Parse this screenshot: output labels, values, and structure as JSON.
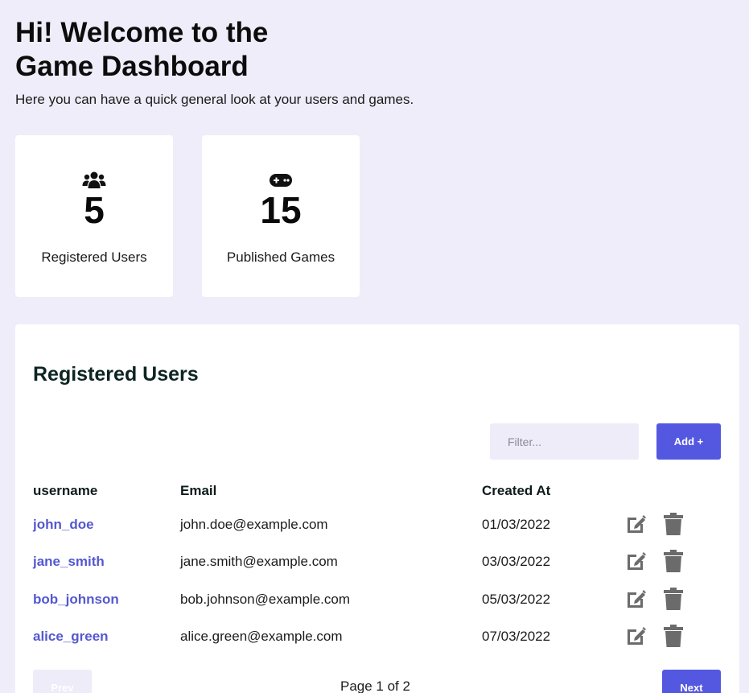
{
  "header": {
    "title": "Hi! Welcome to the Game Dashboard",
    "subtitle": "Here you can have a quick general look at your users and games."
  },
  "stats": {
    "users": {
      "icon": "users-icon",
      "value": "5",
      "label": "Registered Users"
    },
    "games": {
      "icon": "gamepad-icon",
      "value": "15",
      "label": "Published Games"
    }
  },
  "users_panel": {
    "title": "Registered Users",
    "filter_placeholder": "Filter...",
    "add_label": "Add +",
    "columns": {
      "username": "username",
      "email": "Email",
      "created": "Created At"
    },
    "rows": [
      {
        "username": "john_doe",
        "email": "john.doe@example.com",
        "created": "01/03/2022"
      },
      {
        "username": "jane_smith",
        "email": "jane.smith@example.com",
        "created": "03/03/2022"
      },
      {
        "username": "bob_johnson",
        "email": "bob.johnson@example.com",
        "created": "05/03/2022"
      },
      {
        "username": "alice_green",
        "email": "alice.green@example.com",
        "created": "07/03/2022"
      }
    ],
    "row_action_icons": [
      "edit-icon",
      "trash-icon"
    ],
    "pagination": {
      "prev_label": "Prev",
      "page_text": "Page 1 of 2",
      "next_label": "Next"
    }
  },
  "colors": {
    "background": "#eeedf9",
    "accent": "#5458e0",
    "username_link": "#5458d0",
    "action_icon": "#6b6b6b"
  }
}
